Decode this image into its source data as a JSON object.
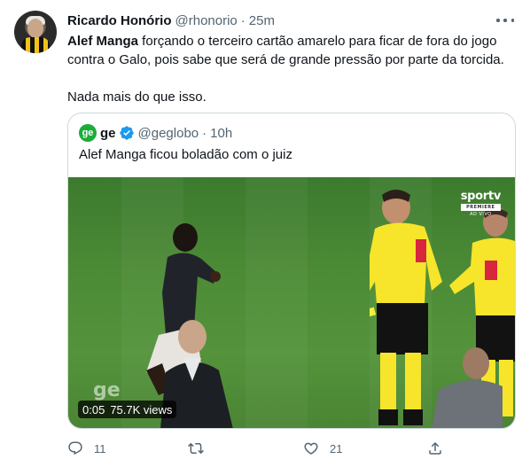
{
  "tweet": {
    "author_name": "Ricardo Honório",
    "author_handle": "@rhonorio",
    "separator": "·",
    "time": "25m",
    "text_bold": "Alef Manga",
    "text_rest": " forçando o terceiro cartão amarelo para ficar de fora do jogo contra o Galo, pois sabe que será de grande pressão por parte da torcida.",
    "text_p2": "Nada mais do que isso."
  },
  "quote": {
    "logo_text": "ge",
    "name": "ge",
    "handle": "@geglobo",
    "separator": "·",
    "time": "10h",
    "text": "Alef Manga ficou boladão com o juiz",
    "video": {
      "duration": "0:05",
      "views": "75.7K views",
      "broadcaster": "sportv",
      "broadcaster_tier": "PREMIERE",
      "broadcaster_live": "AO VIVO",
      "watermark": "ge"
    }
  },
  "actions": {
    "reply_count": "11",
    "retweet_count": "",
    "like_count": "21",
    "icons": [
      "reply-icon",
      "retweet-icon",
      "like-icon",
      "share-icon"
    ]
  },
  "colors": {
    "text_primary": "#0f1419",
    "text_secondary": "#536471",
    "border": "#cfd9de",
    "verified_blue": "#1d9bf0",
    "ge_green": "#1dab39",
    "referee_yellow": "#f6e52a"
  }
}
